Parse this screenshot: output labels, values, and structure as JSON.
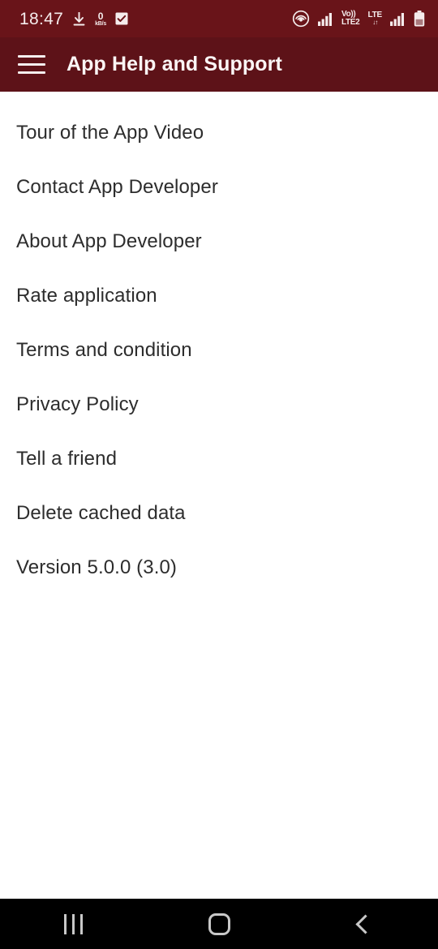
{
  "status_bar": {
    "background": "#691419",
    "foreground": "#f5ecec",
    "clock": "18:47",
    "download_icon": "download-arrow-icon",
    "network_speed_value": "0",
    "network_speed_unit": "kB/s",
    "checkbox_icon": "checkbox-checked-icon",
    "hotspot_icon": "hotspot-broadcast-icon",
    "signal_icon_sim1": "signal-bars-icon",
    "volte_line1": "Vo))",
    "volte_line2": "LTE2",
    "lte_label": "LTE",
    "lte_arrows": "↓↑",
    "signal_icon_sim2": "signal-bars-icon",
    "battery_icon": "battery-icon"
  },
  "app_bar": {
    "background": "#5d1218",
    "menu_icon": "hamburger-menu-icon",
    "title": "App Help and Support"
  },
  "menu": {
    "items": [
      {
        "label": "Tour of the App Video",
        "name": "menu-item-tour-of-the-app-video"
      },
      {
        "label": "Contact App Developer",
        "name": "menu-item-contact-app-developer"
      },
      {
        "label": "About App Developer",
        "name": "menu-item-about-app-developer"
      },
      {
        "label": "Rate application",
        "name": "menu-item-rate-application"
      },
      {
        "label": "Terms and condition",
        "name": "menu-item-terms-and-condition"
      },
      {
        "label": "Privacy Policy",
        "name": "menu-item-privacy-policy"
      },
      {
        "label": "Tell a friend",
        "name": "menu-item-tell-a-friend"
      },
      {
        "label": "Delete cached data",
        "name": "menu-item-delete-cached-data"
      },
      {
        "label": "Version 5.0.0 (3.0)",
        "name": "menu-item-version"
      }
    ]
  },
  "nav_bar": {
    "background": "#000000",
    "recents_icon": "recents-icon",
    "home_icon": "home-icon",
    "back_icon": "back-chevron-icon"
  }
}
